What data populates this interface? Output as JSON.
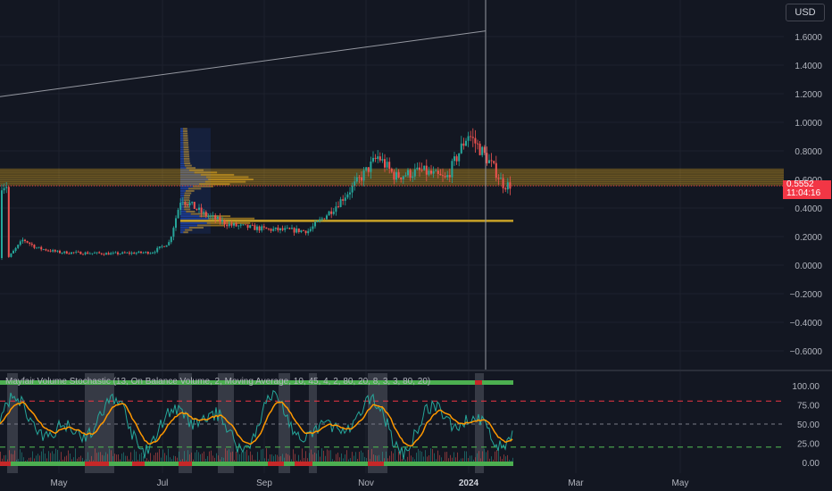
{
  "currency": "USD",
  "current_price": "0.5552",
  "countdown": "11:04:16",
  "indicator_title": "Mayfair Volume Stochastic (13, On Balance Volume, 2, Moving Average, 10, 45, 4, 2, 80, 20, 8, 3, 3, 80, 20)",
  "colors": {
    "background": "#131722",
    "grid": "#1e222d",
    "up": "#26a69a",
    "down": "#ef5350",
    "price_badge": "#f23645",
    "volume_profile_up": "#2962ff",
    "volume_profile_down": "#f5b41e",
    "stoch_k": "#26a69a",
    "stoch_d": "#ff9800",
    "overbought_line": "#f23645",
    "oversold_line": "#4caf50"
  },
  "chart_data": [
    {
      "type": "candlestick",
      "price_axis": {
        "ticks": [
          "1.6000",
          "1.4000",
          "1.2000",
          "1.0000",
          "0.8000",
          "0.6000",
          "0.4000",
          "0.2000",
          "0.0000",
          "−0.2000",
          "−0.4000",
          "−0.6000"
        ],
        "ylim": [
          -0.72,
          1.82
        ]
      },
      "time_axis": {
        "ticks": [
          "May",
          "Jul",
          "Sep",
          "Nov",
          "2024",
          "Mar",
          "May"
        ],
        "bold_tick": "2024"
      },
      "price_path": [
        [
          "Apr 1",
          0.05
        ],
        [
          "Apr 10",
          0.18
        ],
        [
          "Apr 18",
          0.12
        ],
        [
          "May 1",
          0.09
        ],
        [
          "Jun 1",
          0.08
        ],
        [
          "Jun 25",
          0.09
        ],
        [
          "Jul 5",
          0.16
        ],
        [
          "Jul 12",
          0.47
        ],
        [
          "Jul 25",
          0.36
        ],
        [
          "Aug 10",
          0.28
        ],
        [
          "Sep 1",
          0.25
        ],
        [
          "Sep 25",
          0.24
        ],
        [
          "Oct 10",
          0.4
        ],
        [
          "Oct 25",
          0.6
        ],
        [
          "Nov 5",
          0.76
        ],
        [
          "Nov 15",
          0.62
        ],
        [
          "Dec 1",
          0.66
        ],
        [
          "Dec 15",
          0.6
        ],
        [
          "Dec 28",
          0.92
        ],
        [
          "Jan 5",
          0.8
        ],
        [
          "Jan 12",
          0.68
        ],
        [
          "Jan 18",
          0.56
        ]
      ],
      "trendline": {
        "from": [
          "Apr 1",
          1.18
        ],
        "to": [
          "Jan 1",
          1.64
        ]
      },
      "value_area_zone": [
        0.555,
        0.675
      ],
      "support_level": 0.31,
      "volume_profile": {
        "price_range": [
          0.22,
          0.96
        ],
        "note_peak_prices": [
          0.6,
          0.32
        ]
      }
    },
    {
      "type": "line",
      "name": "Mayfair Volume Stochastic",
      "ylim": [
        -10,
        110
      ],
      "ticks": [
        "100.00",
        "75.00",
        "50.00",
        "25.00",
        "0.00"
      ],
      "levels": {
        "overbought": 80,
        "middle": 50,
        "oversold": 20
      }
    }
  ]
}
